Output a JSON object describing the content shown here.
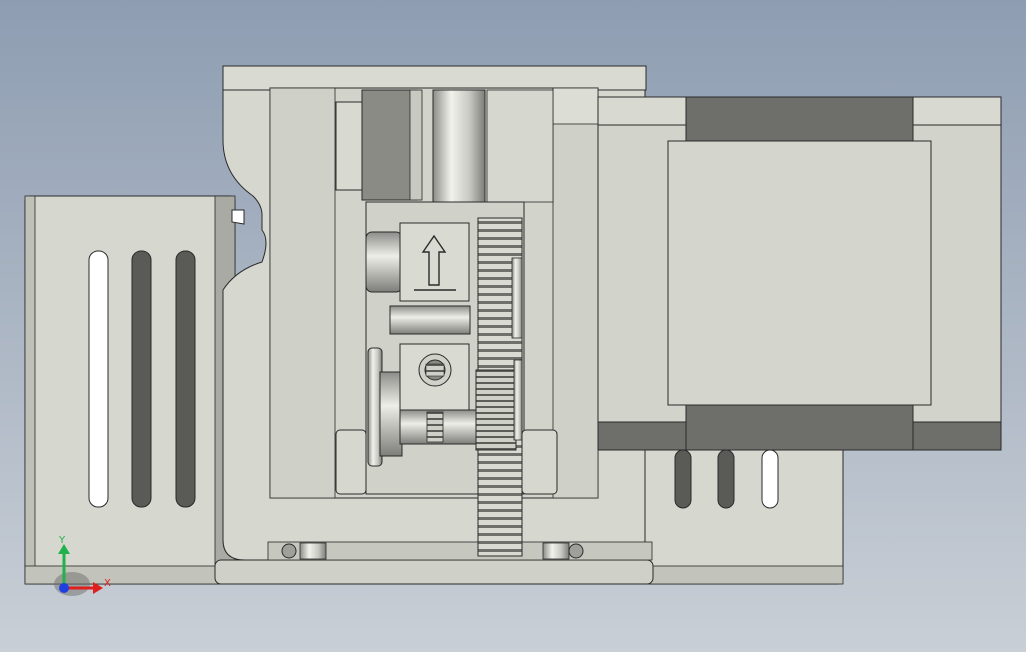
{
  "viewport": {
    "background_top": "#8e9db2",
    "background_bottom": "#c9cfd6"
  },
  "colors": {
    "body_light": "#d6d7cf",
    "body_mid": "#bfc0b8",
    "body_dark": "#8a8b85",
    "slot_dark": "#5a5b57",
    "motor_face": "#d2d3cb",
    "motor_edge": "#6e6f6b",
    "outline": "#2a2a2a",
    "axis_y": "#22b14c",
    "axis_x": "#e01f1f",
    "axis_z": "#1f3fe0"
  },
  "triad": {
    "y_label": "Y",
    "x_label": "X",
    "icon": "coordinate-triad-icon"
  },
  "component_icons": {
    "arrow": "up-arrow-icon",
    "gear": "spur-gear-icon"
  }
}
